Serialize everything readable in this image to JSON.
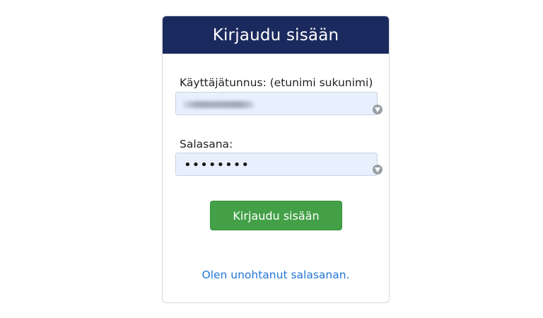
{
  "login": {
    "title": "Kirjaudu sisään",
    "username_label": "Käyttäjätunnus: (etunimi sukunimi)",
    "password_label": "Salasana:",
    "password_value": "••••••••",
    "submit_label": "Kirjaudu sisään",
    "forgot_link": "Olen unohtanut salasanan."
  },
  "colors": {
    "header_bg": "#1b2a5e",
    "button_bg": "#43a047",
    "link": "#2275d7",
    "autofill_bg": "#e8f0fe"
  },
  "icons": {
    "field_manager": "password-manager-icon"
  }
}
